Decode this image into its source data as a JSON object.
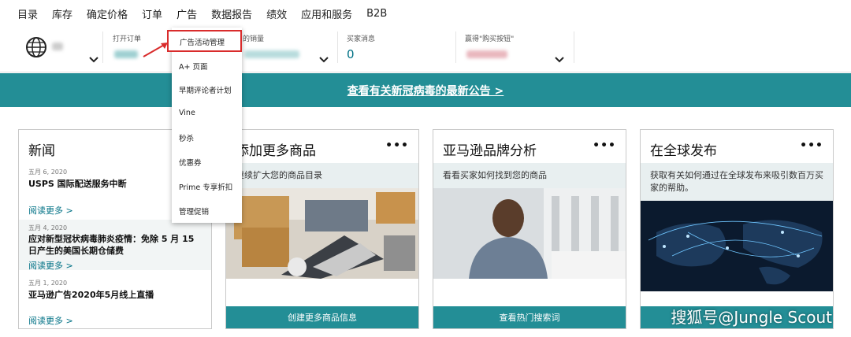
{
  "nav": {
    "items": [
      "目录",
      "库存",
      "确定价格",
      "订单",
      "广告",
      "数据报告",
      "绩效",
      "应用和服务",
      "B2B"
    ]
  },
  "metrics": {
    "open_orders_label": "打开订单",
    "sales_label": "的销量",
    "buyer_messages_label": "买家消息",
    "buyer_messages_value": "0",
    "buy_box_label": "赢得\"购买按钮\""
  },
  "dropdown": {
    "items": [
      "广告活动管理",
      "A+ 页面",
      "早期评论者计划",
      "Vine",
      "秒杀",
      "优惠券",
      "Prime 专享折扣",
      "管理促销"
    ]
  },
  "banner": {
    "text": "查看有关新冠病毒的最新公告 >"
  },
  "news": {
    "title": "新闻",
    "items": [
      {
        "date": "五月 6, 2020",
        "headline": "USPS 国际配送服务中断",
        "more": "阅读更多 >"
      },
      {
        "date": "五月 4, 2020",
        "headline": "应对新型冠状病毒肺炎疫情：免除 5 月 15 日产生的美国长期仓储费",
        "more": "阅读更多 >"
      },
      {
        "date": "五月 1, 2020",
        "headline": "亚马逊广告2020年5月线上直播",
        "more": "阅读更多 >"
      }
    ]
  },
  "cards": [
    {
      "title": "添加更多商品",
      "subtitle": "继续扩大您的商品目录",
      "button": "创建更多商品信息",
      "menu": "•••"
    },
    {
      "title": "亚马逊品牌分析",
      "subtitle": "看看买家如何找到您的商品",
      "button": "查看热门搜索词",
      "menu": "•••"
    },
    {
      "title": "在全球发布",
      "subtitle": "获取有关如何通过在全球发布来吸引数百万买家的帮助。",
      "button": "",
      "menu": "•••"
    }
  ],
  "watermark": "搜狐号@Jungle Scout",
  "colors": {
    "teal": "#238e96",
    "link": "#007185",
    "highlight": "#d92c2c"
  }
}
